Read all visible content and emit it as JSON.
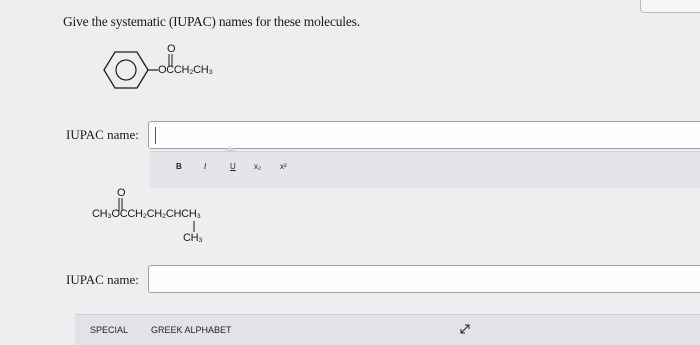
{
  "question": {
    "text": "Give the systematic (IUPAC) names for these molecules."
  },
  "molecule1": {
    "oxygen": "O",
    "formula": "OCCH₂CH₃"
  },
  "answer1": {
    "label": "IUPAC name:",
    "value": ""
  },
  "toolbar": {
    "bold": "B",
    "italic": "I",
    "underline": "U",
    "subscript": "x₂",
    "superscript": "x²"
  },
  "molecule2": {
    "oxygen": "O",
    "formula": "CH₃OCCH₂CH₂CHCH₃",
    "branch": "CH₃"
  },
  "answer2": {
    "label": "IUPAC name:",
    "value": ""
  },
  "bottom_bar": {
    "special": "SPECIAL",
    "greek": "GREEK ALPHABET"
  }
}
